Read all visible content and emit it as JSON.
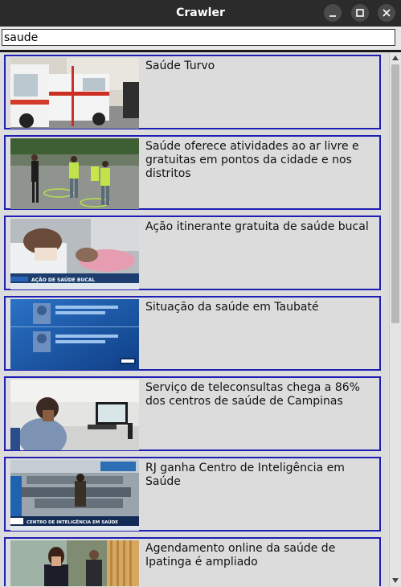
{
  "window": {
    "title": "Crawler"
  },
  "search": {
    "value": "saude"
  },
  "results": [
    {
      "title": "Saúde Turvo"
    },
    {
      "title": "Saúde oferece atividades ao ar livre e gratuitas em pontos da cidade e nos distritos"
    },
    {
      "title": "Ação itinerante gratuita de saúde bucal"
    },
    {
      "title": "Situação da saúde em Taubaté"
    },
    {
      "title": "Serviço de teleconsultas chega a 86% dos centros de saúde de Campinas"
    },
    {
      "title": "RJ ganha Centro de Inteligência em Saúde"
    },
    {
      "title": "Agendamento online da saúde de Ipatinga é ampliado"
    }
  ],
  "thumbnails": {
    "3": {
      "banner": "AÇÃO DE SAÚDE BUCAL"
    },
    "6": {
      "banner": "CENTRO DE INTELIGÊNCIA EM SAÚDE"
    }
  }
}
